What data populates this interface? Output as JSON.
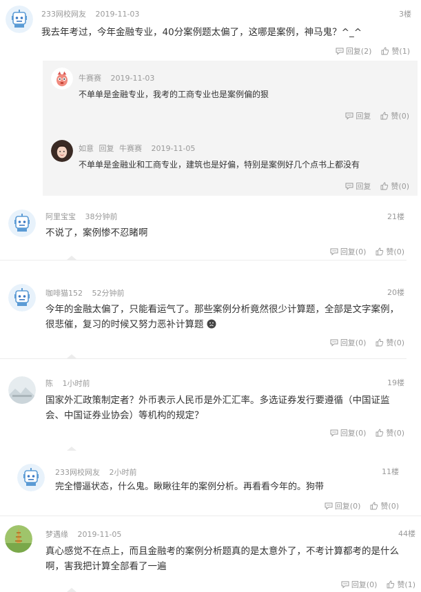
{
  "comments": [
    {
      "name": "233网校网友",
      "time": "2019-11-03",
      "floor": "3楼",
      "text": "我去年考过，今年金融专业，40分案例题太偏了，这哪是案例，神马鬼？^_^",
      "reply_label": "回复(2)",
      "like_label": "赞(1)"
    },
    {
      "name": "阿里宝宝",
      "time": "38分钟前",
      "floor": "21楼",
      "text": "不说了，案例惨不忍睹啊",
      "reply_label": "回复(0)",
      "like_label": "赞(0)"
    },
    {
      "name": "咖啡猫152",
      "time": "52分钟前",
      "floor": "20楼",
      "text1": "今年的金融太偏了，只能看运气了。那些案例分析竟然很少计算题，全部是文字案例，",
      "text2": "很悲催，复习的时候又努力恶补计算题",
      "reply_label": "回复(0)",
      "like_label": "赞(0)"
    },
    {
      "name": "陈",
      "time": "1小时前",
      "floor": "19楼",
      "text1": "国家外汇政策制定者？外币表示人民币是外汇汇率。多选证券发行要遵循（中国证监",
      "text2": "会、中国证券业协会）等机构的规定？",
      "reply_label": "回复(0)",
      "like_label": "赞(0)"
    },
    {
      "name": "233网校网友",
      "time": "2小时前",
      "floor": "11楼",
      "text": "完全懵逼状态，什么鬼。瞅瞅往年的案例分析。再看看今年的。狗带",
      "reply_label": "回复(0)",
      "like_label": "赞(0)"
    },
    {
      "name": "梦遇缘",
      "time": "2019-11-05",
      "floor": "44楼",
      "text1": "真心感觉不在点上，而且金融考的案例分析题真的是太意外了，不考计算都考的是什么",
      "text2": "啊，害我把计算全部看了一遍",
      "reply_label": "回复(0)",
      "like_label": "赞(1)"
    }
  ],
  "replies": [
    {
      "name": "牛赛赛",
      "time": "2019-11-03",
      "text": "不单单是金融专业，我考的工商专业也是案例偏的狠",
      "reply_label": "回复",
      "like_label": "赞(0)"
    },
    {
      "name": "如意",
      "reply_word": "回复",
      "reply_to": "牛赛赛",
      "time": "2019-11-05",
      "text": "不单单是金融业和工商专业，建筑也是好偏，特别是案例好几个点书上都没有",
      "reply_label": "回复",
      "like_label": "赞(0)"
    }
  ],
  "colors": {
    "meta": "#999999",
    "text": "#333333",
    "reply_bg": "#f4f4f4"
  }
}
